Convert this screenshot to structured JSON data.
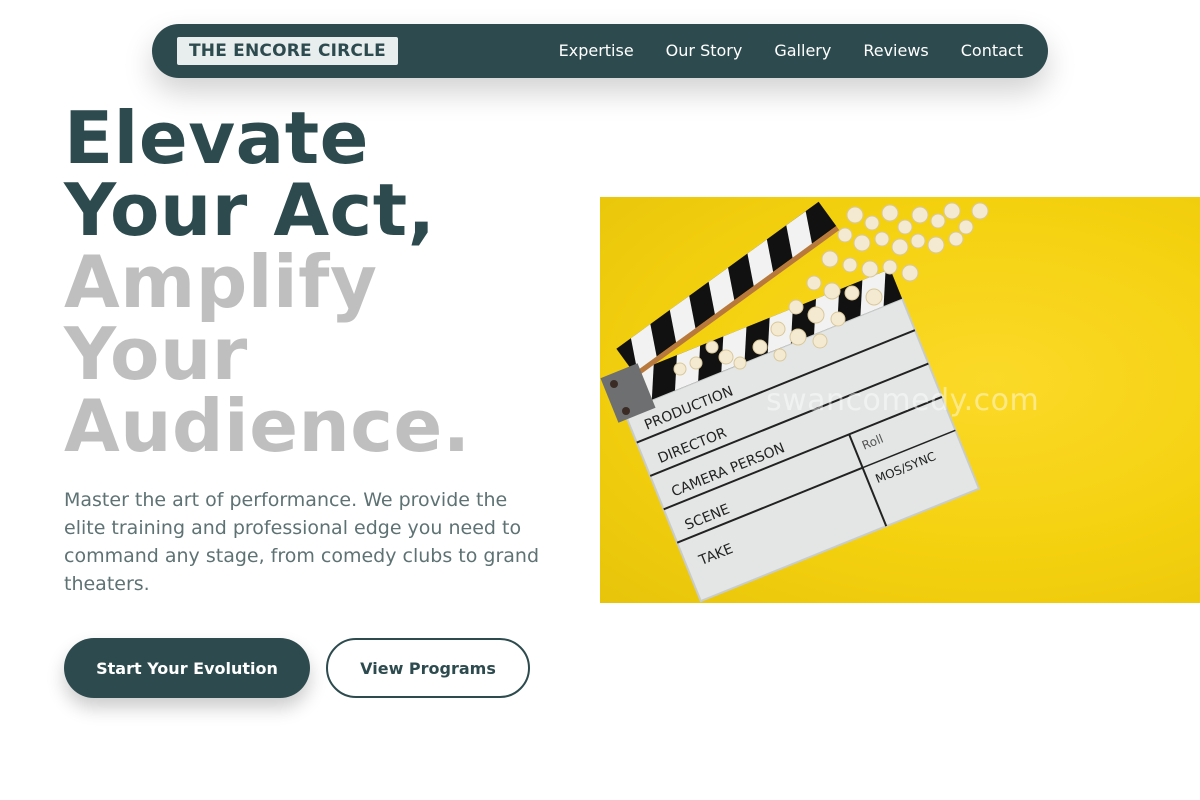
{
  "nav": {
    "logo": "THE ENCORE CIRCLE",
    "links": [
      "Expertise",
      "Our Story",
      "Gallery",
      "Reviews",
      "Contact"
    ]
  },
  "hero": {
    "headline_dark": [
      "Elevate",
      "Your Act,"
    ],
    "headline_light": [
      "Amplify",
      "Your",
      "Audience."
    ],
    "subtitle": "Master the art of performance. We provide the elite training and professional edge you need to command any stage, from comedy clubs to grand theaters.",
    "primary_button": "Start Your Evolution",
    "secondary_button": "View Programs"
  },
  "image": {
    "watermark": "swancomedy.com",
    "clapboard_labels": [
      "PRODUCTION",
      "DIRECTOR",
      "CAMERA PERSON",
      "SCENE",
      "TAKE",
      "Roll",
      "MOS/SYNC"
    ]
  },
  "colors": {
    "primary": "#2d4b4e",
    "muted_headline": "#bfbfbf",
    "body_text": "#5e7274",
    "image_background": "#f4d10f"
  }
}
